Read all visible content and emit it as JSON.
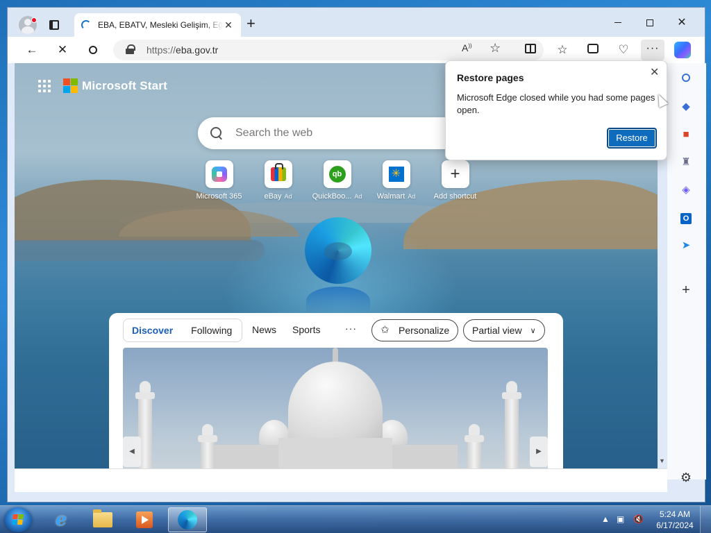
{
  "tab": {
    "title": "EBA, EBATV, Mesleki Gelişim, Eğitim"
  },
  "address": {
    "protocol": "https://",
    "domain": "eba.gov.tr"
  },
  "start_page": {
    "brand": "Microsoft Start",
    "search_placeholder": "Search the web",
    "shortcuts": [
      {
        "label": "Microsoft 365",
        "ad": ""
      },
      {
        "label": "eBay",
        "ad": "Ad"
      },
      {
        "label": "QuickBoo...",
        "ad": "Ad"
      },
      {
        "label": "Walmart",
        "ad": "Ad"
      },
      {
        "label": "Add shortcut",
        "ad": ""
      }
    ],
    "feed": {
      "tabs": [
        "Discover",
        "Following"
      ],
      "links": [
        "News",
        "Sports"
      ],
      "more": "···",
      "personalize": "Personalize",
      "view": "Partial view"
    }
  },
  "restore_popup": {
    "title": "Restore pages",
    "message": "Microsoft Edge closed while you had some pages open.",
    "button": "Restore"
  },
  "taskbar": {
    "time": "5:24 AM",
    "date": "6/17/2024"
  },
  "colors": {
    "accent": "#0f6cbd",
    "feed_active": "#1b5fb8",
    "ms_red": "#f25022",
    "ms_green": "#7fba00",
    "ms_blue": "#00a4ef",
    "ms_yellow": "#ffb900"
  }
}
